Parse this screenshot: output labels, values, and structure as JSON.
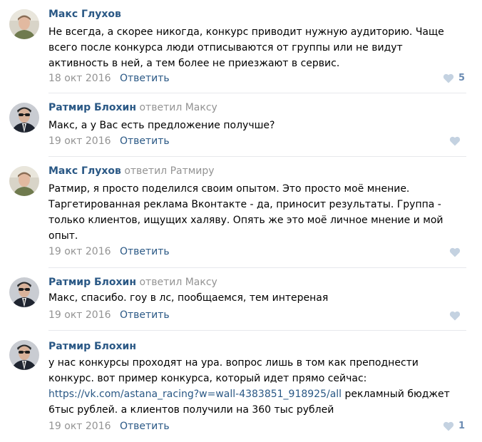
{
  "ui": {
    "reply_label": "Ответить"
  },
  "comments": [
    {
      "author": "Макс Глухов",
      "reply_to": "",
      "text_lines": [
        "Не всегда, а скорее никогда, конкурс приводит нужную аудиторию. Чаще",
        "всего после конкурса люди отписываются от группы или не видут",
        "активность в ней, а тем более не приезжают в сервис."
      ],
      "date": "18 окт 2016",
      "likes": "5"
    },
    {
      "author": "Ратмир Блохин",
      "reply_to": "ответил Максу",
      "text_lines": [
        "Макс, а у Вас есть предложение получше?"
      ],
      "date": "19 окт 2016",
      "likes": ""
    },
    {
      "author": "Макс Глухов",
      "reply_to": "ответил Ратмиру",
      "text_lines": [
        "Ратмир, я просто поделился своим опытом. Это просто моё мнение.",
        "Таргетированная реклама Вконтакте - да, приносит результаты. Группа -",
        "только клиентов, ищущих халяву. Опять же это моё личное мнение и мой",
        "опыт."
      ],
      "date": "19 окт 2016",
      "likes": ""
    },
    {
      "author": "Ратмир Блохин",
      "reply_to": "ответил Максу",
      "text_lines": [
        "Макс, спасибо. гоу в лс, пообщаемся, тем интереная"
      ],
      "date": "19 окт 2016",
      "likes": ""
    },
    {
      "author": "Ратмир Блохин",
      "reply_to": "",
      "text_lines": [
        "у нас конкурсы проходят на ура. вопрос лишь в том как преподнести",
        "конкурс. вот пример конкурса, который идет прямо сейчас:"
      ],
      "link": "https://vk.com/astana_racing?w=wall-4383851_918925/all",
      "link_suffix": " рекламный бюджет",
      "text_lines_after": [
        "6тыс рублей. а клиентов получили на 360 тыс рублей"
      ],
      "date": "19 окт 2016",
      "likes": "1"
    }
  ]
}
